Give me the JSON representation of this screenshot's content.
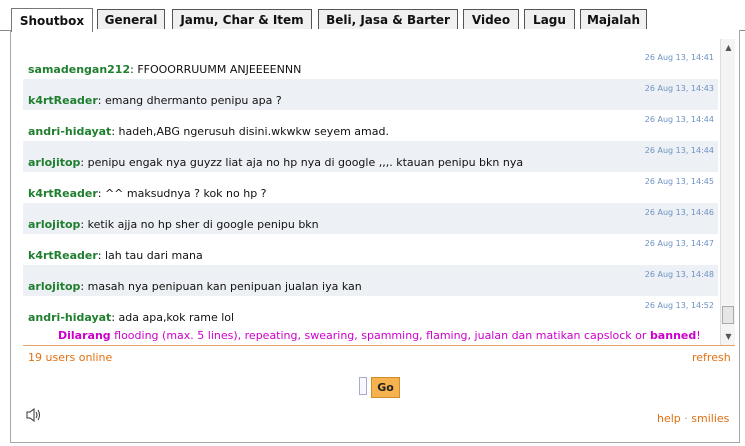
{
  "tabs": [
    "Shoutbox",
    "General",
    "Jamu, Char & Item",
    "Beli, Jasa & Barter",
    "Video",
    "Lagu",
    "Majalah"
  ],
  "messages": [
    {
      "user": "samadengan212",
      "text": ": FFOOORRUUMM ANJEEEENNN",
      "time": "26 Aug 13, 14:41"
    },
    {
      "user": "k4rtReader",
      "text": ": emang dhermanto penipu apa ?",
      "time": "26 Aug 13, 14:43"
    },
    {
      "user": "andri-hidayat",
      "text": ": hadeh,ABG ngerusuh disini.wkwkw seyem amad.",
      "time": "26 Aug 13, 14:44"
    },
    {
      "user": "arlojitop",
      "text": ": penipu engak nya guyzz liat aja no hp nya di google ,,,. ktauan penipu bkn nya",
      "time": "26 Aug 13, 14:44"
    },
    {
      "user": "k4rtReader",
      "text": ": ^^ maksudnya ? kok no hp ?",
      "time": "26 Aug 13, 14:45"
    },
    {
      "user": "arlojitop",
      "text": ": ketik ajja no hp sher di google penipu bkn",
      "time": "26 Aug 13, 14:46"
    },
    {
      "user": "k4rtReader",
      "text": ": lah tau dari mana",
      "time": "26 Aug 13, 14:47"
    },
    {
      "user": "arlojitop",
      "text": ": masah nya penipuan kan penipuan jualan iya kan",
      "time": "26 Aug 13, 14:48"
    },
    {
      "user": "andri-hidayat",
      "text": ": ada apa,kok rame lol",
      "time": "26 Aug 13, 14:52"
    }
  ],
  "warning": {
    "prefix": "Dilarang",
    "body": " flooding (max. 5 lines), repeating, swearing, spamming, flaming, jualan dan matikan capslock or ",
    "banned": "banned",
    "suffix": "!"
  },
  "status": {
    "users_online": "19 users online",
    "refresh": "refresh"
  },
  "input": {
    "value": "",
    "go_label": "Go"
  },
  "footer": {
    "help": "help",
    "sep": " · ",
    "smilies": "smilies"
  },
  "icons": {
    "speaker": "speaker-icon"
  },
  "colors": {
    "username": "#1f7f2f",
    "timestamp": "#6d92c3",
    "link": "#e07010",
    "warning": "#cc00cc",
    "go_button": "#f6b24f"
  }
}
